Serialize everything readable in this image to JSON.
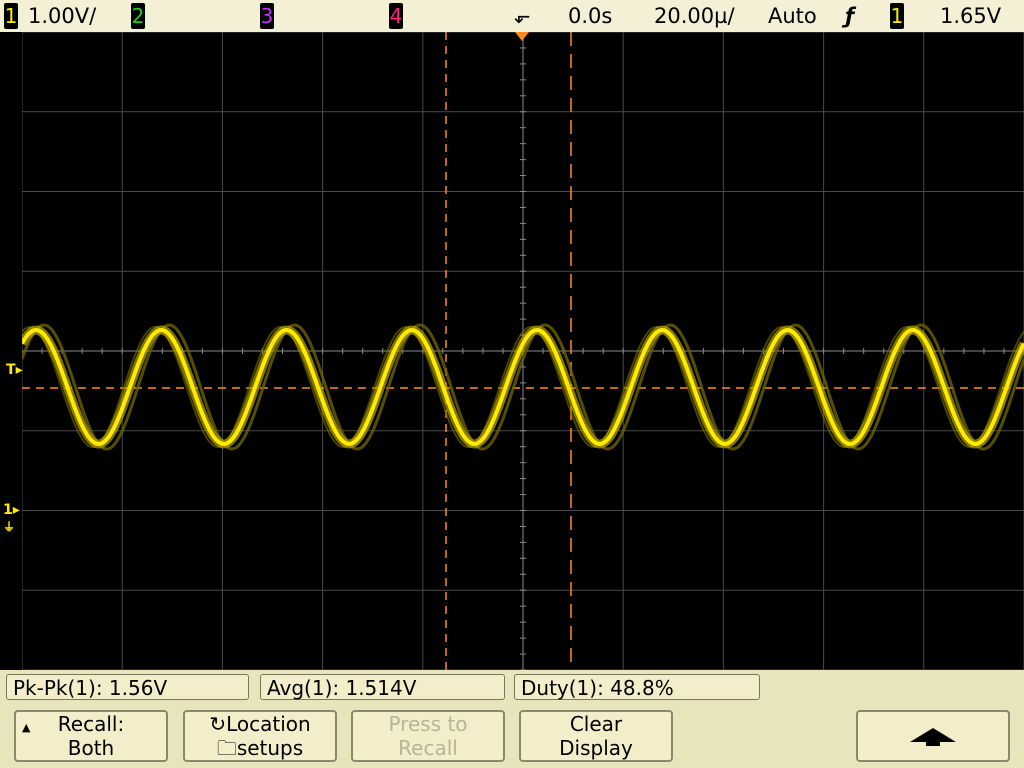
{
  "topbar": {
    "ch1_num": "1",
    "ch1_scale": "1.00V/",
    "ch2_num": "2",
    "ch3_num": "3",
    "ch4_num": "4",
    "delay": "0.0s",
    "timebase": "20.00µ/",
    "trigger_mode": "Auto",
    "trigger_source": "1",
    "trigger_level": "1.65V"
  },
  "markers": {
    "trigger": "T",
    "ch1_ground": "1"
  },
  "measurements": [
    {
      "label": "Pk-Pk(1): 1.56V"
    },
    {
      "label": "Avg(1): 1.514V"
    },
    {
      "label": "Duty(1): 48.8%"
    }
  ],
  "softkeys": {
    "recall_line1": "Recall:",
    "recall_line2": "Both",
    "location_line1": "Location",
    "location_line2": "setups",
    "press_line1": "Press to",
    "press_line2": "Recall",
    "clear_line1": "Clear",
    "clear_line2": "Display"
  },
  "colors": {
    "ch1": "#ffea00",
    "ch2": "#1fd11f",
    "ch3": "#c030ff",
    "ch4": "#ff2080",
    "cursor": "#ff8a1a",
    "grid": "#4a4a4a",
    "grid_axis": "#8a8a8a"
  },
  "waveform": {
    "channel": "1",
    "periods_visible": 8,
    "peak_to_peak": "1.56V",
    "average": "1.514V"
  }
}
